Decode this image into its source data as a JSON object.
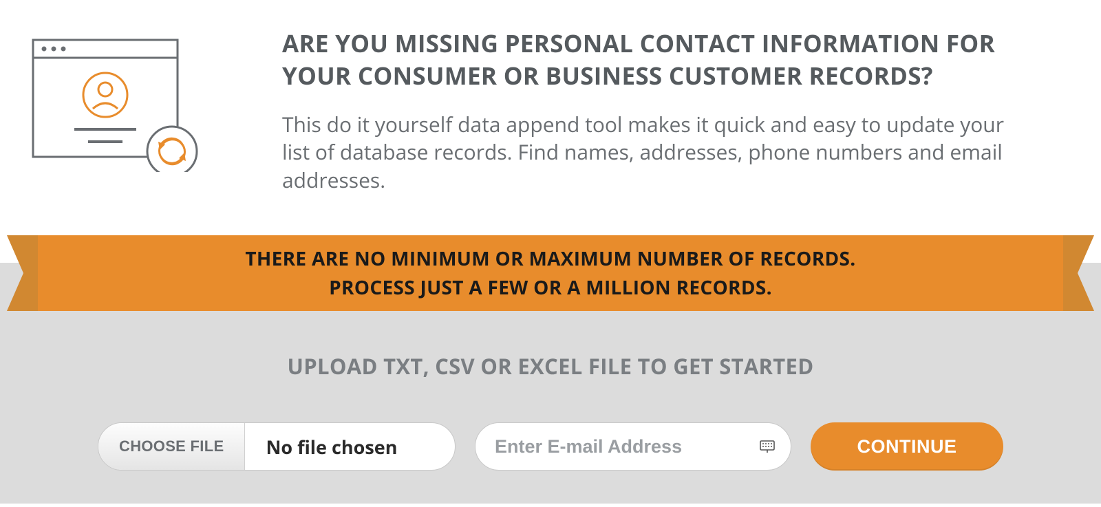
{
  "top": {
    "headline": "ARE YOU MISSING PERSONAL CONTACT INFORMATION FOR YOUR CONSUMER OR BUSINESS CUSTOMER RECORDS?",
    "description": "This do it yourself data append tool makes it quick and easy to update your list of database records. Find names, addresses, phone numbers and email addresses."
  },
  "ribbon": {
    "line1": "THERE ARE NO MINIMUM OR MAXIMUM NUMBER OF RECORDS.",
    "line2": "PROCESS JUST A FEW OR A MILLION RECORDS."
  },
  "bottom": {
    "heading": "UPLOAD TXT, CSV OR EXCEL FILE TO GET STARTED",
    "choose_file_label": "CHOOSE FILE",
    "file_status": "No file chosen",
    "email_placeholder": "Enter E-mail Address",
    "continue_label": "CONTINUE"
  },
  "colors": {
    "accent": "#e88c2c",
    "accent_dark": "#d18831",
    "text_heading": "#555a5e",
    "text_body": "#6a6e72",
    "gray_bg": "#dcdcdc"
  }
}
